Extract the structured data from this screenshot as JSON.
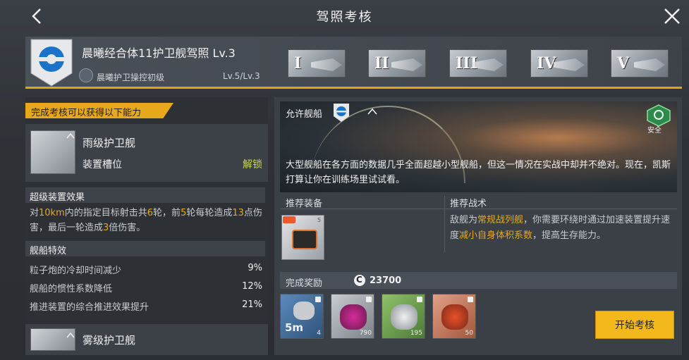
{
  "header": {
    "title": "驾照考核"
  },
  "license": {
    "name": "晨曦经合体11护卫舰驾照 Lv.3",
    "skill_name": "晨曦护卫操控初级",
    "skill_level": "Lv.5/Lv.3"
  },
  "tiers": [
    "I",
    "II",
    "III",
    "IV",
    "V"
  ],
  "left": {
    "gain_title": "完成考核可以获得以下能力",
    "ship1": {
      "name": "雨级护卫舰",
      "slot_label": "装置槽位",
      "unlock_label": "解锁"
    },
    "super_title": "超级装置效果",
    "super_desc": {
      "p1": "对",
      "v1": "10km",
      "p2": "内的指定目标射击共",
      "v2": "6",
      "p3": "轮，前",
      "v3": "5",
      "p4": "轮每轮造成",
      "v4": "13",
      "p5": "点伤害，最后一轮造成",
      "v5": "3",
      "p6": "倍伤害。"
    },
    "ship_fx_title": "舰船特效",
    "stats": [
      {
        "label": "粒子炮的冷却时间减少",
        "value": "9%"
      },
      {
        "label": "舰船的惯性系数降低",
        "value": "12%"
      },
      {
        "label": "推进装置的综合推进效果提升",
        "value": "21%"
      }
    ],
    "ship2": {
      "name": "雾级护卫舰"
    }
  },
  "right": {
    "allow_label": "允许舰船",
    "safe_label": "安全",
    "intro": "大型舰船在各方面的数据几乎全面超越小型舰船，但这一情况在实战中却并不绝对。现在，凯斯打算让你在训练场里试试看。",
    "rec_eq_label": "推荐装备",
    "rec_tac_label": "推荐战术",
    "equip_level": "5",
    "tactic": {
      "p1": "敌舰为",
      "h1": "常规战列舰",
      "p2": "，你需要环绕时通过加速装置提升速度",
      "h2": "减小自身体积系数",
      "p3": "，提高生存能力。"
    },
    "reward_label": "完成奖励",
    "coins": "23700",
    "rewards": [
      {
        "name": "5m",
        "count": "4"
      },
      {
        "name": "",
        "count": "790"
      },
      {
        "name": "",
        "count": "195"
      },
      {
        "name": "",
        "count": "50"
      }
    ],
    "start_label": "开始考核"
  },
  "colors": {
    "accent": "#e8a81c",
    "unlock": "#c6d84a",
    "button": "#f2b81c"
  }
}
